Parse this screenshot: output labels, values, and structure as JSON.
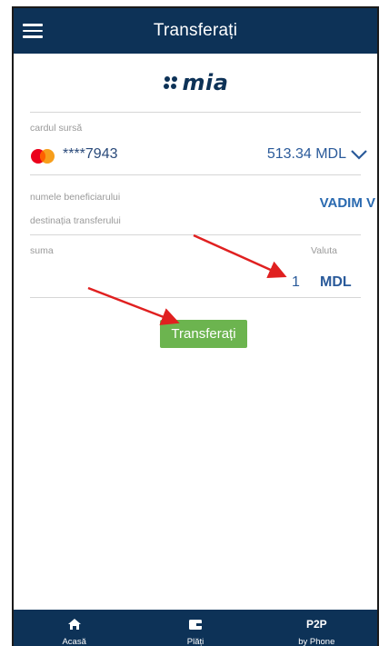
{
  "app": {
    "title": "Transferați",
    "logo_text": "mia"
  },
  "source_card": {
    "label": "cardul sursă",
    "card_brand_icon": "mastercard-icon",
    "number": "****7943",
    "balance": "513.34 MDL"
  },
  "beneficiary": {
    "label": "numele beneficiarului",
    "value": "VADIM V"
  },
  "destination": {
    "label": "destinația transferului"
  },
  "amount": {
    "label": "suma",
    "value": "1"
  },
  "currency": {
    "label": "Valuta",
    "value": "MDL"
  },
  "submit_label": "Transferați",
  "bottom_nav": {
    "items": [
      {
        "label": "Acasă",
        "icon": "home-icon"
      },
      {
        "label": "Plăți",
        "icon": "wallet-icon"
      },
      {
        "label": "by Phone",
        "icon_text": "P2P"
      }
    ]
  },
  "colors": {
    "primary": "#0d3257",
    "button": "#6cb44f",
    "annotation_arrow": "#e02020"
  }
}
